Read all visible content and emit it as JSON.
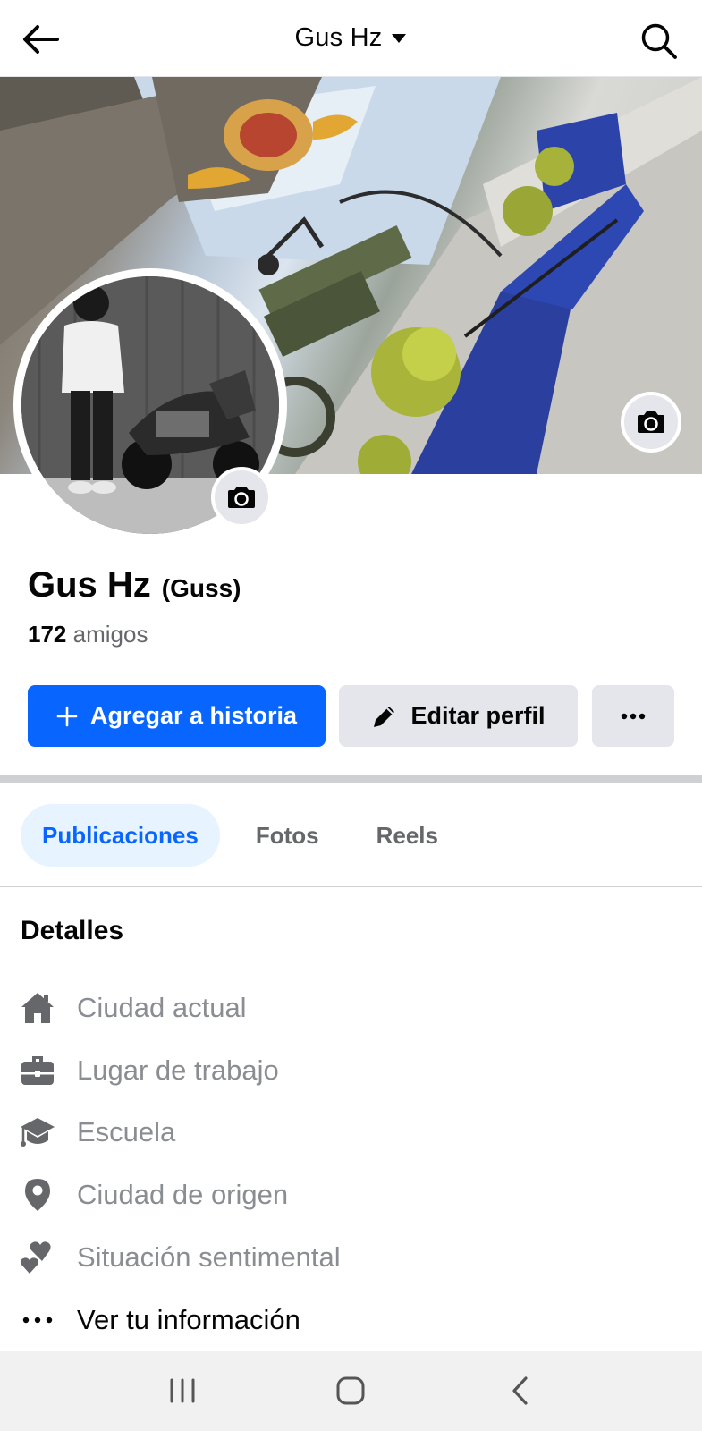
{
  "header": {
    "title": "Gus Hz",
    "back_icon": "arrow-left-icon",
    "dropdown_icon": "caret-down-icon",
    "search_icon": "search-icon"
  },
  "profile": {
    "name": "Gus Hz",
    "alternate_name": "(Guss)",
    "friends_count": "172",
    "friends_label": "amigos"
  },
  "actions": {
    "add_story_label": "Agregar a historia",
    "edit_profile_label": "Editar perfil",
    "more_icon": "ellipsis-icon",
    "primary_color": "#0866ff"
  },
  "tabs": [
    {
      "label": "Publicaciones",
      "active": true
    },
    {
      "label": "Fotos",
      "active": false
    },
    {
      "label": "Reels",
      "active": false
    }
  ],
  "details": {
    "title": "Detalles",
    "items": [
      {
        "icon": "home-icon",
        "label": "Ciudad actual"
      },
      {
        "icon": "briefcase-icon",
        "label": "Lugar de trabajo"
      },
      {
        "icon": "graduation-cap-icon",
        "label": "Escuela"
      },
      {
        "icon": "location-pin-icon",
        "label": "Ciudad de origen"
      },
      {
        "icon": "hearts-icon",
        "label": "Situación sentimental"
      },
      {
        "icon": "ellipsis-icon",
        "label": "Ver tu información"
      }
    ]
  },
  "navbar": {
    "items": [
      "recent-apps-icon",
      "home-button-icon",
      "back-chevron-icon"
    ]
  }
}
